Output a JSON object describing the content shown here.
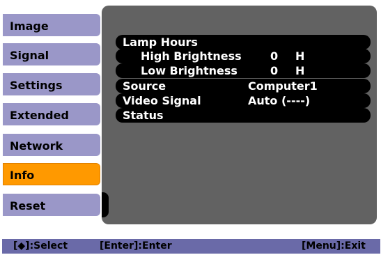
{
  "menu": {
    "items": [
      {
        "label": "Image"
      },
      {
        "label": "Signal"
      },
      {
        "label": "Settings"
      },
      {
        "label": "Extended"
      },
      {
        "label": "Network"
      },
      {
        "label": "Info"
      },
      {
        "label": "Reset"
      }
    ],
    "selected": "Info"
  },
  "info": {
    "lamp_hours_label": "Lamp Hours",
    "high_brightness_label": "High Brightness",
    "high_brightness_value": "0",
    "high_brightness_unit": "H",
    "low_brightness_label": "Low Brightness",
    "low_brightness_value": "0",
    "low_brightness_unit": "H",
    "source_label": "Source",
    "source_value": "Computer1",
    "video_signal_label": "Video Signal",
    "video_signal_value": "Auto (----)",
    "status_label": "Status"
  },
  "footer": {
    "select_hint": "[◆]:Select",
    "enter_hint": "[Enter]:Enter",
    "exit_hint": "[Menu]:Exit"
  },
  "colors": {
    "menu_item": "#9a97c8",
    "menu_selected": "#ff9900",
    "panel": "#626262",
    "row_bar": "#000000",
    "footer_bar": "#6a6aa8"
  }
}
